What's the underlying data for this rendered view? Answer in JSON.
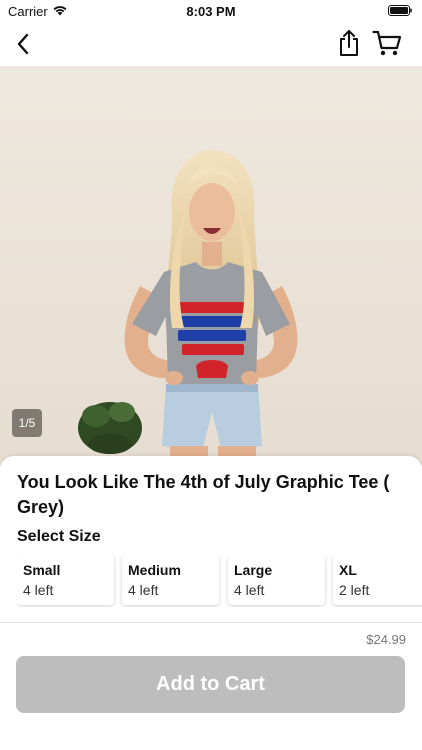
{
  "status_bar": {
    "carrier": "Carrier",
    "time": "8:03 PM"
  },
  "nav": {
    "back_icon": "chevron-left-icon",
    "share_icon": "share-icon",
    "cart_icon": "cart-icon"
  },
  "gallery": {
    "counter": "1/5"
  },
  "product": {
    "title": "You Look Like The 4th of July Graphic Tee ( Grey)",
    "select_size_label": "Select Size",
    "sizes": [
      {
        "name": "Small",
        "stock": "4 left"
      },
      {
        "name": "Medium",
        "stock": "4 left"
      },
      {
        "name": "Large",
        "stock": "4 left"
      },
      {
        "name": "XL",
        "stock": "2 left"
      }
    ],
    "price": "$24.99",
    "add_to_cart_label": "Add to Cart"
  },
  "colors": {
    "button_disabled": "#bdbdbd",
    "accent_red": "#d2232a",
    "accent_blue": "#1f3fa8"
  }
}
